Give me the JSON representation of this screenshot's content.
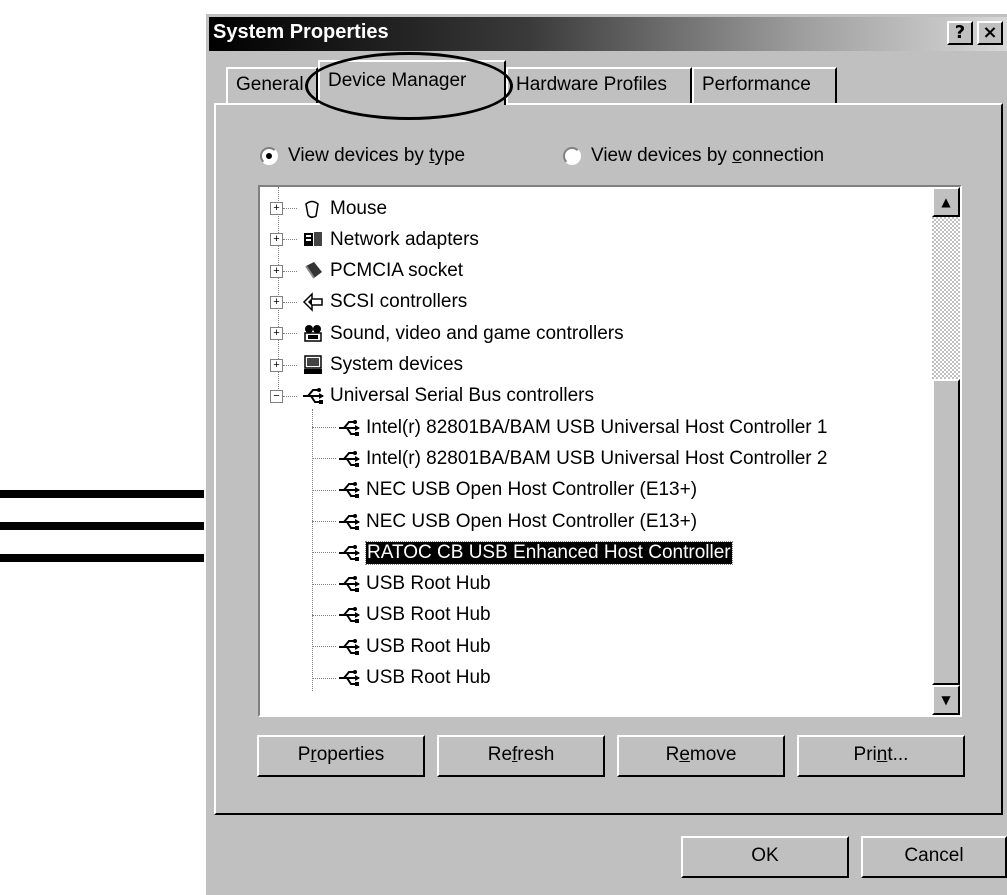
{
  "window": {
    "title": "System Properties",
    "help_label": "?",
    "close_label": "×"
  },
  "tabs": [
    "General",
    "Device Manager",
    "Hardware Profiles",
    "Performance"
  ],
  "view": {
    "by_type": {
      "pre": "View devices by ",
      "key": "t",
      "post": "ype",
      "checked": true
    },
    "by_connection": {
      "pre": "View devices by ",
      "key": "c",
      "post": "onnection",
      "checked": false
    }
  },
  "tree": {
    "categories": [
      {
        "label": "Mouse",
        "icon": "mouse-icon",
        "expander": "+"
      },
      {
        "label": "Network adapters",
        "icon": "network-adapter-icon",
        "expander": "+"
      },
      {
        "label": "PCMCIA socket",
        "icon": "pcmcia-socket-icon",
        "expander": "+"
      },
      {
        "label": "SCSI controllers",
        "icon": "scsi-controller-icon",
        "expander": "+"
      },
      {
        "label": "Sound, video and game controllers",
        "icon": "sound-video-icon",
        "expander": "+"
      },
      {
        "label": "System devices",
        "icon": "system-devices-icon",
        "expander": "+"
      },
      {
        "label": "Universal Serial Bus controllers",
        "icon": "usb-icon",
        "expander": "−"
      }
    ],
    "usb_children": [
      {
        "label": "Intel(r) 82801BA/BAM USB Universal Host Controller 1",
        "selected": false
      },
      {
        "label": "Intel(r) 82801BA/BAM USB Universal Host Controller 2",
        "selected": false
      },
      {
        "label": "NEC USB Open Host Controller (E13+)",
        "selected": false
      },
      {
        "label": "NEC USB Open Host Controller (E13+)",
        "selected": false
      },
      {
        "label": "RATOC CB USB Enhanced Host Controller",
        "selected": true
      },
      {
        "label": "USB Root Hub",
        "selected": false
      },
      {
        "label": "USB Root Hub",
        "selected": false
      },
      {
        "label": "USB Root Hub",
        "selected": false
      },
      {
        "label": "USB Root Hub",
        "selected": false
      }
    ]
  },
  "buttons": {
    "properties": {
      "pre": "P",
      "key": "r",
      "post": "operties"
    },
    "refresh": {
      "pre": "Re",
      "key": "f",
      "post": "resh"
    },
    "remove": {
      "pre": "R",
      "key": "e",
      "post": "move"
    },
    "print": {
      "pre": "Pri",
      "key": "n",
      "post": "t..."
    },
    "ok": "OK",
    "cancel": "Cancel"
  }
}
